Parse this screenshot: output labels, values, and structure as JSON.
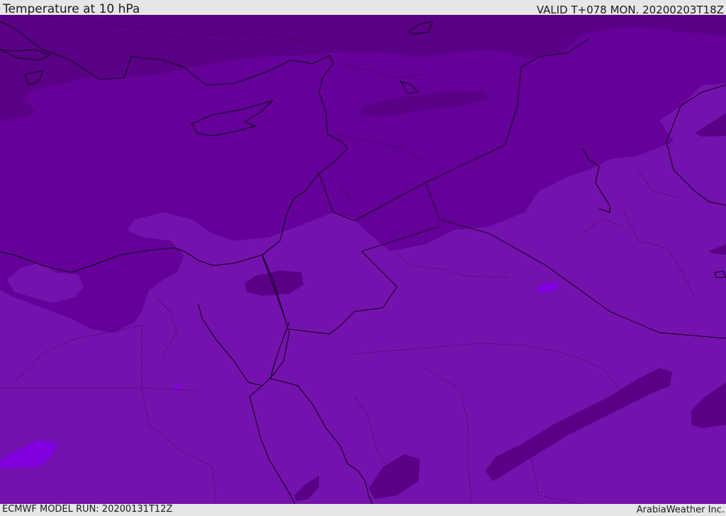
{
  "header": {
    "title": "Temperature at 10 hPa",
    "valid": "VALID T+078 MON. 20200203T18Z"
  },
  "footer": {
    "model_run": "ECMWF MODEL RUN: 20200131T12Z",
    "credit": "ArabiaWeather Inc."
  },
  "colors": {
    "band_coldest": "#5a0086",
    "band_cold": "#650099",
    "band_mid": "#7412ad",
    "band_warm": "#8000e0",
    "coastline": "#0a0010",
    "frame_bg": "#e6e6e6"
  }
}
